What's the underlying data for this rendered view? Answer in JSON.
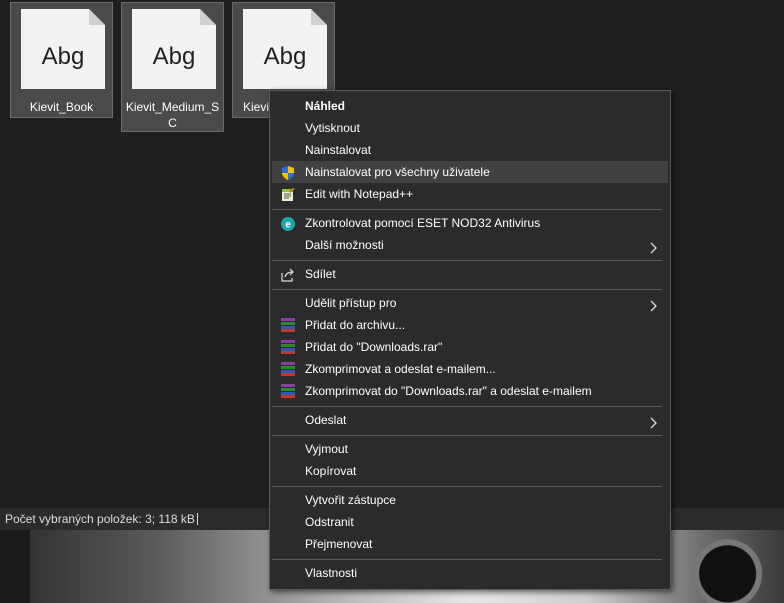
{
  "files": [
    {
      "name": "Kievit_Book",
      "thumb_text": "Abg"
    },
    {
      "name": "Kievit_Medium_SC",
      "thumb_text": "Abg"
    },
    {
      "name": "Kievi",
      "thumb_text": "Abg"
    }
  ],
  "status": {
    "text": "Počet vybraných položek: 3; 118 kB"
  },
  "menu": {
    "items": [
      {
        "label": "Náhled"
      },
      {
        "label": "Vytisknout"
      },
      {
        "label": "Nainstalovat"
      },
      {
        "label": "Nainstalovat pro všechny uživatele"
      },
      {
        "label": "Edit with Notepad++"
      },
      {
        "label": "Zkontrolovat pomocí ESET NOD32 Antivirus"
      },
      {
        "label": "Další možnosti"
      },
      {
        "label": "Sdílet"
      },
      {
        "label": "Udělit přístup pro"
      },
      {
        "label": "Přidat do archivu..."
      },
      {
        "label": "Přidat do \"Downloads.rar\""
      },
      {
        "label": "Zkomprimovat a odeslat e-mailem..."
      },
      {
        "label": "Zkomprimovat do \"Downloads.rar\" a odeslat e-mailem"
      },
      {
        "label": "Odeslat"
      },
      {
        "label": "Vyjmout"
      },
      {
        "label": "Kopírovat"
      },
      {
        "label": "Vytvořit zástupce"
      },
      {
        "label": "Odstranit"
      },
      {
        "label": "Přejmenovat"
      },
      {
        "label": "Vlastnosti"
      }
    ]
  },
  "colors": {
    "menu_bg": "#2b2b2b",
    "highlight": "#414141",
    "eset": "#1aa7a7"
  }
}
